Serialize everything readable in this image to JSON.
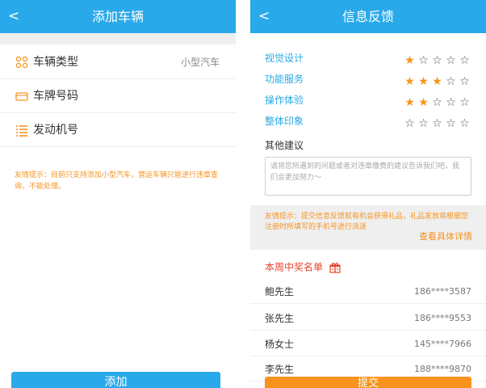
{
  "add_vehicle": {
    "back_glyph": "<",
    "title": "添加车辆",
    "rows": [
      {
        "label": "车辆类型",
        "value": "小型汽车",
        "icon": "vehicle-type-icon"
      },
      {
        "label": "车牌号码",
        "value": "",
        "icon": "license-plate-icon"
      },
      {
        "label": "发动机号",
        "value": "",
        "icon": "engine-number-icon"
      }
    ],
    "notice": "友情提示：目前只支持添加小型汽车，营运车辆只能进行违章查询，不能处理。",
    "add_button": "添加"
  },
  "feedback": {
    "back_glyph": "<",
    "title": "信息反馈",
    "ratings": [
      {
        "label": "视觉设计",
        "stars": 1,
        "max": 5
      },
      {
        "label": "功能服务",
        "stars": 3,
        "max": 5
      },
      {
        "label": "操作体验",
        "stars": 2,
        "max": 5
      },
      {
        "label": "整体印象",
        "stars": 0,
        "max": 5
      }
    ],
    "other_title": "其他建议",
    "suggestion_placeholder": "请将您所遇到的问题或者对违章缴费的建议告诉我们吧，我们会更加努力～",
    "tip": "友情提示：提交信息反馈就有机会获得礼品，礼品发放将根据您注册时所填写的手机号进行派送",
    "tip_link": "查看具体详情",
    "winners_title": "本周中奖名单",
    "winners": [
      {
        "name": "鲍先生",
        "phone": "186****3587"
      },
      {
        "name": "张先生",
        "phone": "186****9553"
      },
      {
        "name": "杨女士",
        "phone": "145****7966"
      },
      {
        "name": "李先生",
        "phone": "188****9870"
      }
    ],
    "submit_button": "提交"
  },
  "colors": {
    "accent": "#29a9ea",
    "orange": "#f7931e",
    "red": "#e8412b"
  }
}
